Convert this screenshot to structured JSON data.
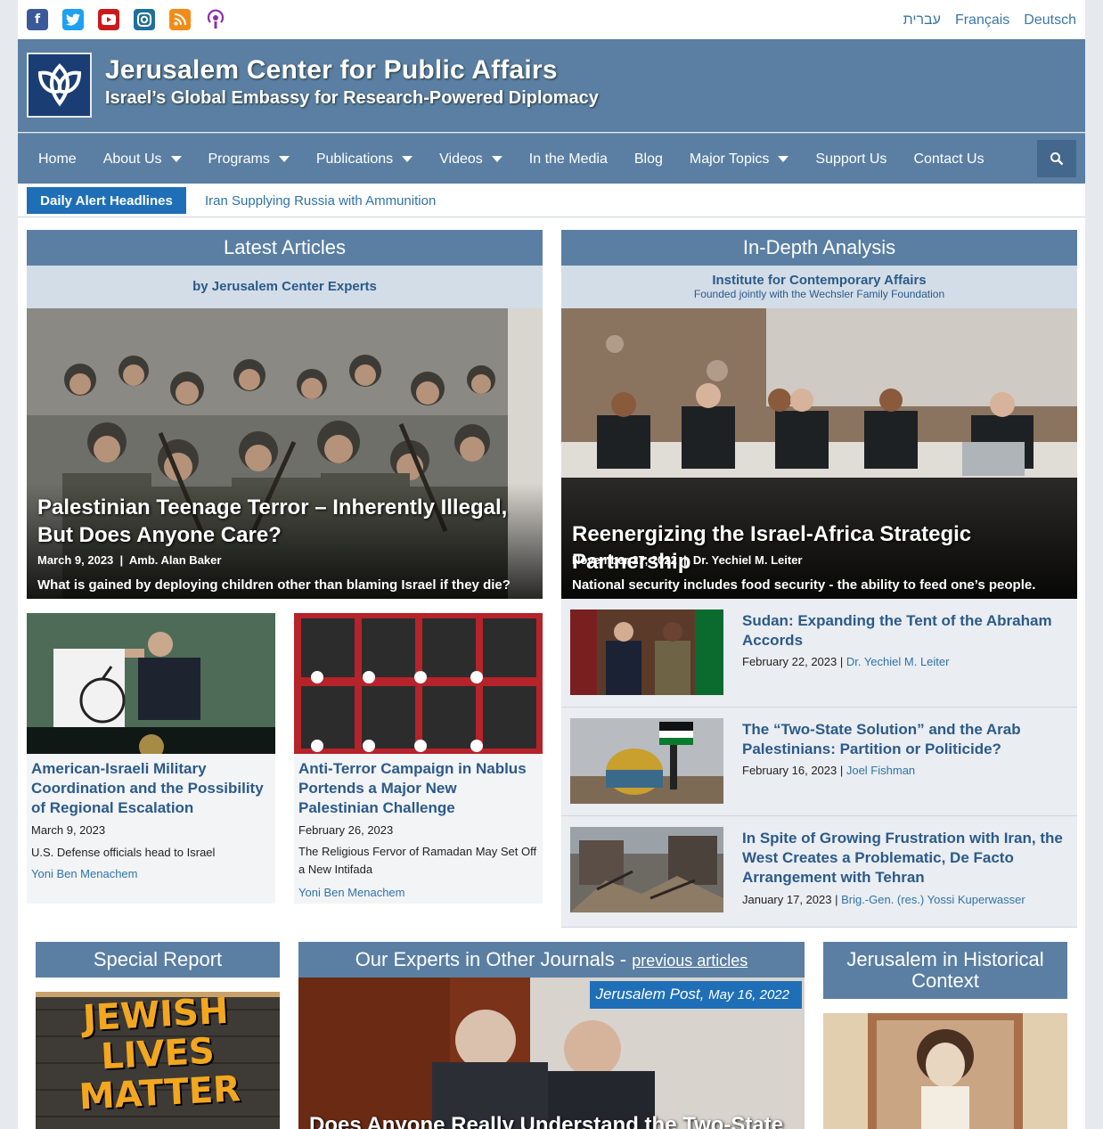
{
  "social": [
    "facebook-icon",
    "twitter-icon",
    "youtube-icon",
    "instagram-icon",
    "rss-icon",
    "podcast-icon"
  ],
  "languages": [
    "עברית",
    "Français",
    "Deutsch"
  ],
  "site": {
    "title": "Jerusalem Center for Public Affairs",
    "tagline": "Israel’s Global Embassy for Research-Powered Diplomacy"
  },
  "nav": [
    {
      "label": "Home"
    },
    {
      "label": "About Us"
    },
    {
      "label": "Programs"
    },
    {
      "label": "Publications"
    },
    {
      "label": "Videos"
    },
    {
      "label": "In the Media"
    },
    {
      "label": "Blog"
    },
    {
      "label": "Major Topics"
    },
    {
      "label": "Support Us"
    },
    {
      "label": "Contact Us"
    }
  ],
  "alert": {
    "label": "Daily Alert Headlines",
    "headline": "Iran Supplying Russia with Ammunition"
  },
  "latest": {
    "heading": "Latest Articles",
    "subheading": "by Jerusalem Center Experts",
    "feature": {
      "title": "Palestinian Teenage Terror – Inherently Illegal, But Does Anyone Care?",
      "date": "March 9, 2023",
      "author": "Amb. Alan Baker",
      "desc": "What is gained by deploying children other than blaming Israel if they die?"
    },
    "cards": [
      {
        "title": "American-Israeli Military Coordination and the Possibility of Regional Escalation",
        "date": "March 9, 2023",
        "desc": "U.S. Defense officials head to Israel",
        "author": "Yoni Ben Menachem"
      },
      {
        "title": "Anti-Terror Campaign in Nablus Portends a Major New Palestinian Challenge",
        "date": "February 26, 2023",
        "desc": "The Religious Fervor of Ramadan May Set Off a New Intifada",
        "author": "Yoni Ben Menachem"
      }
    ]
  },
  "indepth": {
    "heading": "In-Depth Analysis",
    "institute": "Institute for Contemporary Affairs",
    "founded": "Founded jointly with the Wechsler Family Foundation",
    "feature": {
      "title": "Reenergizing the Israel-Africa Strategic Partnership",
      "date": "November 27, 2022",
      "author": "Dr. Yechiel M. Leiter",
      "desc": "National security includes food security - the ability to feed one’s people."
    },
    "items": [
      {
        "title": "Sudan: Expanding the Tent of the Abraham Accords",
        "date": "February 22, 2023",
        "author": "Dr. Yechiel M. Leiter"
      },
      {
        "title": "The “Two-State Solution” and the Arab Palestinians: Partition or Politicide?",
        "date": "February 16, 2023",
        "author": "Joel Fishman"
      },
      {
        "title": "In Spite of Growing Frustration with Iran, the West Creates a Problematic, De Facto Arrangement with Tehran",
        "date": "January 17, 2023",
        "author": "Brig.-Gen. (res.) Yossi Kuperwasser"
      }
    ]
  },
  "special": {
    "heading": "Special Report",
    "poster": [
      "JEWISH",
      "LIVES",
      "MATTER"
    ]
  },
  "journals": {
    "heading": "Our Experts in Other Journals - ",
    "link": "previous articles",
    "source": "Jerusalem Post",
    "date": "May 16, 2022",
    "title": "Does Anyone Really Understand the Two-State"
  },
  "historical": {
    "heading": "Jerusalem in Historical Context"
  },
  "colors": {
    "nav": "#5a7fa3",
    "alert": "#1e6fb8",
    "link": "#2b5a8a",
    "logo": "#1a3e74"
  }
}
